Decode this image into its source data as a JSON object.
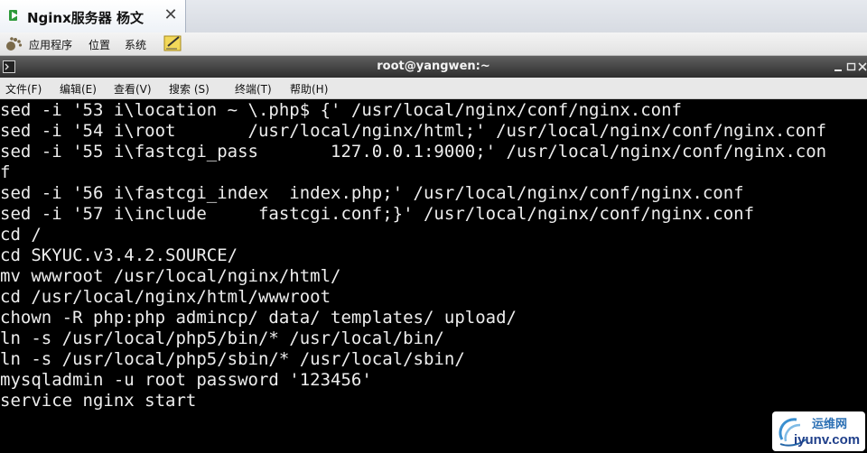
{
  "vm_tab": {
    "title": "Nginx服务器 杨文",
    "close_glyph": "✕"
  },
  "panel": {
    "applications": "应用程序",
    "places": "位置",
    "system": "系统"
  },
  "terminal_window": {
    "title": "root@yangwen:~"
  },
  "terminal_menu": [
    {
      "label": "文件(F)"
    },
    {
      "label": "编辑(E)"
    },
    {
      "label": "查看(V)"
    },
    {
      "label": "搜索 (S)"
    },
    {
      "label": "终端(T)"
    },
    {
      "label": "帮助(H)"
    }
  ],
  "terminal_lines": [
    "sed -i '53 i\\location ~ \\.php$ {' /usr/local/nginx/conf/nginx.conf",
    "sed -i '54 i\\root       /usr/local/nginx/html;' /usr/local/nginx/conf/nginx.conf",
    "sed -i '55 i\\fastcgi_pass       127.0.0.1:9000;' /usr/local/nginx/conf/nginx.con",
    "f",
    "sed -i '56 i\\fastcgi_index  index.php;' /usr/local/nginx/conf/nginx.conf",
    "sed -i '57 i\\include     fastcgi.conf;}' /usr/local/nginx/conf/nginx.conf",
    "cd /",
    "cd SKYUC.v3.4.2.SOURCE/",
    "mv wwwroot /usr/local/nginx/html/",
    "cd /usr/local/nginx/html/wwwroot",
    "chown -R php:php admincp/ data/ templates/ upload/",
    "ln -s /usr/local/php5/bin/* /usr/local/bin/",
    "ln -s /usr/local/php5/sbin/* /usr/local/sbin/",
    "mysqladmin -u root password '123456'",
    "service nginx start"
  ],
  "watermark": {
    "site_name": "运维网",
    "url": "iyunv.com"
  },
  "colors": {
    "terminal_bg": "#000000",
    "terminal_fg": "#ededed",
    "titlebar": "#3a3a3a"
  }
}
